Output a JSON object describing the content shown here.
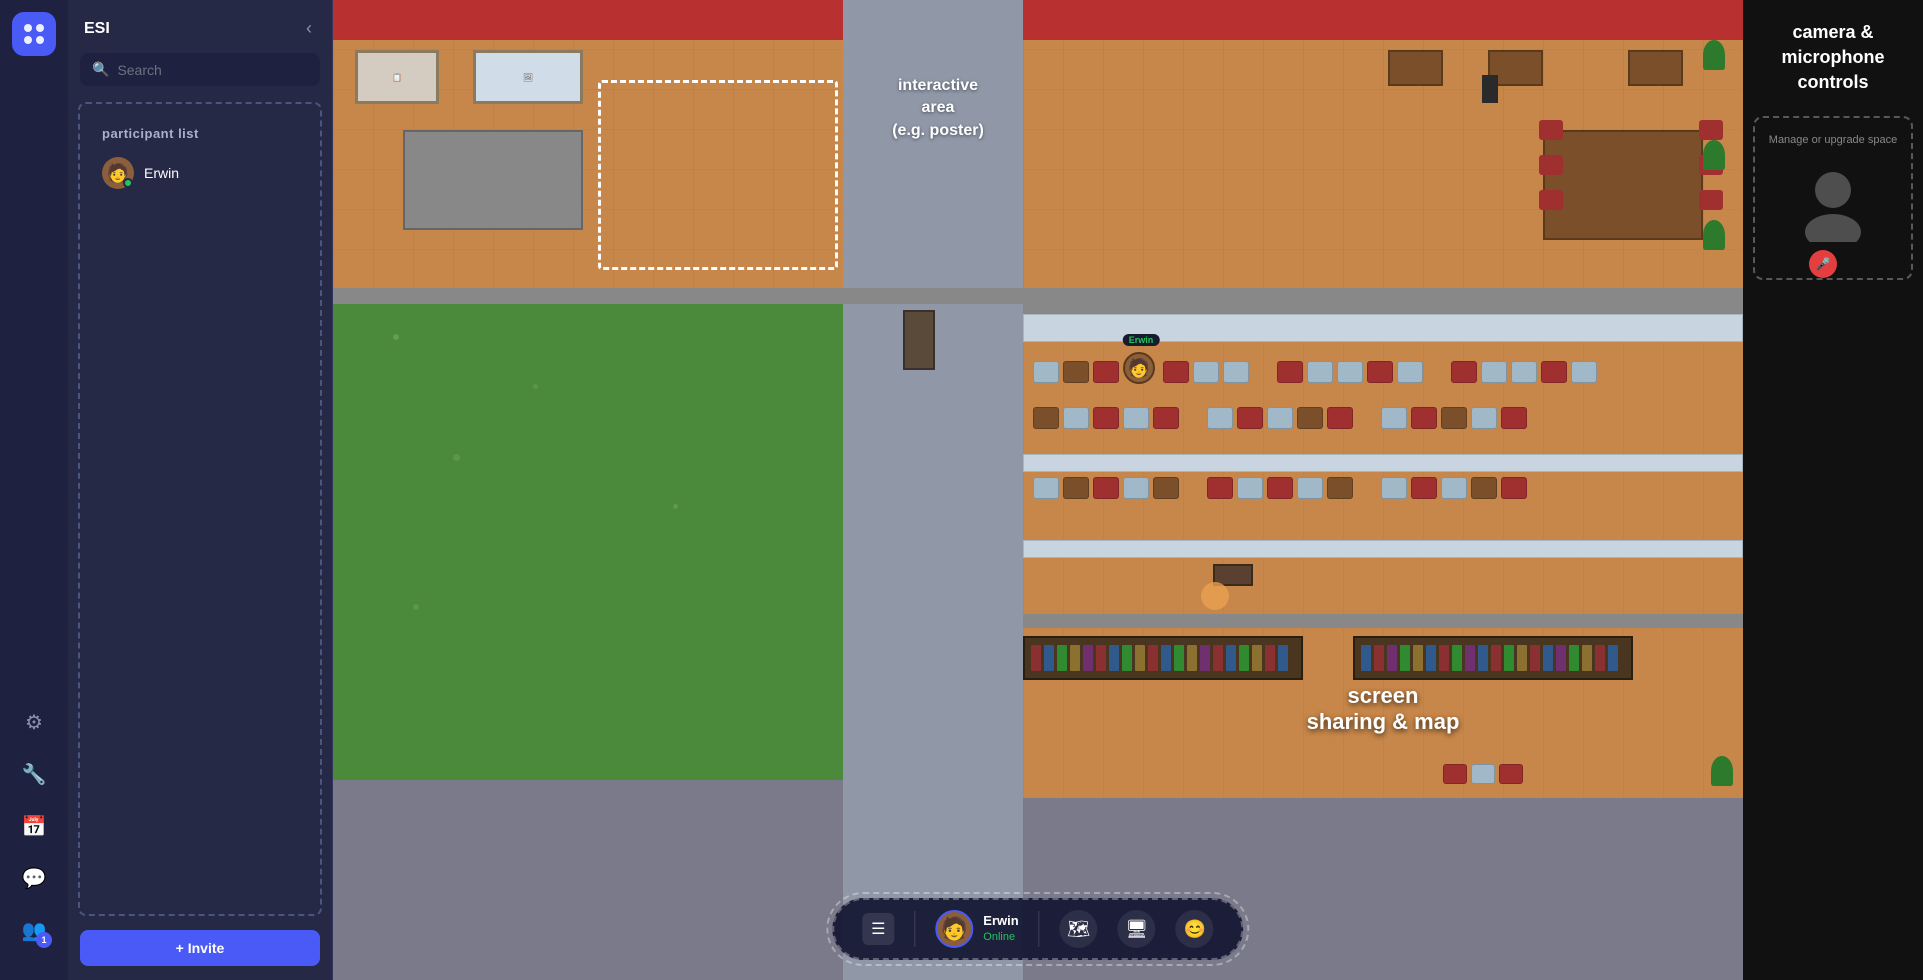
{
  "sidebar": {
    "logo": "◈",
    "icons": [
      {
        "name": "gear-icon",
        "glyph": "⚙",
        "label": "Settings"
      },
      {
        "name": "wrench-icon",
        "glyph": "🔧",
        "label": "Tools"
      },
      {
        "name": "calendar-icon",
        "glyph": "📅",
        "label": "Schedule"
      },
      {
        "name": "chat-icon",
        "glyph": "💬",
        "label": "Chat"
      },
      {
        "name": "people-icon",
        "glyph": "👥",
        "label": "People",
        "badge": "1"
      }
    ]
  },
  "panel": {
    "title": "ESI",
    "close_label": "‹",
    "search_placeholder": "Search",
    "section_title": "participant list",
    "participants": [
      {
        "name": "Erwin",
        "status": "online"
      }
    ],
    "invite_label": "+ Invite"
  },
  "game": {
    "interactive_area_label": "interactive\narea\n(e.g. poster)",
    "screen_sharing_label": "screen\nsharing & map",
    "player_name": "Erwin",
    "player_status": "Online"
  },
  "bottom_bar": {
    "user_name": "Erwin",
    "user_status": "Online",
    "map_icon": "🗺",
    "screen_icon": "🖥",
    "emoji_icon": "😊"
  },
  "right_panel": {
    "camera_label": "camera &\nmicrophone\ncontrols",
    "manage_text": "Manage or upgrade space",
    "mic_icon": "🎤"
  }
}
